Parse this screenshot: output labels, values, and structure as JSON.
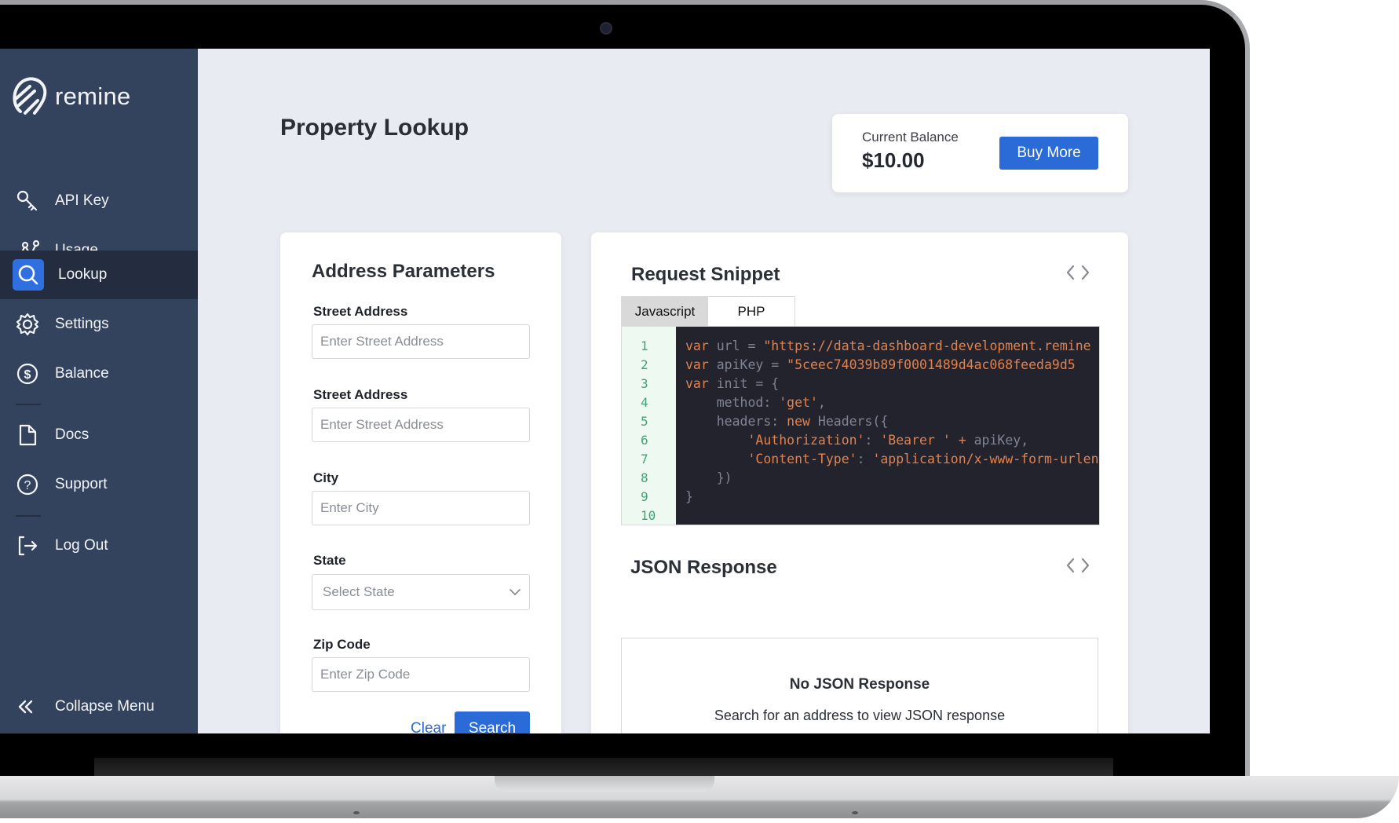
{
  "brand": {
    "name": "remine"
  },
  "sidebar": {
    "items": [
      {
        "label": "API Key",
        "icon": "key-icon"
      },
      {
        "label": "Usage",
        "icon": "usage-graph-icon"
      },
      {
        "label": "Lookup",
        "icon": "search-icon",
        "active": true
      },
      {
        "label": "Settings",
        "icon": "gear-icon"
      },
      {
        "label": "Balance",
        "icon": "dollar-circle-icon"
      },
      {
        "label": "Docs",
        "icon": "document-icon"
      },
      {
        "label": "Support",
        "icon": "help-circle-icon"
      },
      {
        "label": "Log Out",
        "icon": "logout-icon"
      }
    ],
    "collapse_label": "Collapse Menu"
  },
  "page": {
    "title": "Property Lookup"
  },
  "balance": {
    "label": "Current Balance",
    "value": "$10.00",
    "buy_label": "Buy More"
  },
  "address_form": {
    "heading": "Address Parameters",
    "fields": [
      {
        "label": "Street Address",
        "placeholder": "Enter Street Address",
        "value": ""
      },
      {
        "label": "Street Address",
        "placeholder": "Enter Street Address",
        "value": ""
      },
      {
        "label": "City",
        "placeholder": "Enter City",
        "value": ""
      },
      {
        "label": "State",
        "placeholder": "Select State",
        "value": ""
      },
      {
        "label": "Zip Code",
        "placeholder": "Enter Zip Code",
        "value": ""
      }
    ],
    "clear_label": "Clear",
    "search_label": "Search"
  },
  "snippet": {
    "heading": "Request Snippet",
    "tabs": [
      {
        "label": "Javascript",
        "active": true
      },
      {
        "label": "PHP",
        "active": false
      }
    ],
    "line_numbers": [
      "1",
      "2",
      "3",
      "4",
      "5",
      "6",
      "7",
      "8",
      "9",
      "10"
    ],
    "lines": [
      [
        {
          "t": "var ",
          "c": "kw"
        },
        {
          "t": "url = ",
          "c": "pl"
        },
        {
          "t": "\"https://data-dashboard-development.remine",
          "c": "str"
        }
      ],
      [
        {
          "t": "var ",
          "c": "kw"
        },
        {
          "t": "apiKey = ",
          "c": "pl"
        },
        {
          "t": "\"5ceec74039b89f0001489d4ac068feeda9d5",
          "c": "str"
        }
      ],
      [
        {
          "t": "var ",
          "c": "kw"
        },
        {
          "t": "init = {",
          "c": "pl"
        }
      ],
      [
        {
          "t": "    method: ",
          "c": "pl"
        },
        {
          "t": "'get'",
          "c": "str"
        },
        {
          "t": ",",
          "c": "pl"
        }
      ],
      [
        {
          "t": "    headers: ",
          "c": "pl"
        },
        {
          "t": "new ",
          "c": "kw"
        },
        {
          "t": "Headers({",
          "c": "pl"
        }
      ],
      [
        {
          "t": "        ",
          "c": "pl"
        },
        {
          "t": "'Authorization'",
          "c": "str"
        },
        {
          "t": ": ",
          "c": "pl"
        },
        {
          "t": "'Bearer '",
          "c": "str"
        },
        {
          "t": " + ",
          "c": "kw"
        },
        {
          "t": "apiKey,",
          "c": "pl"
        }
      ],
      [
        {
          "t": "        ",
          "c": "pl"
        },
        {
          "t": "'Content-Type'",
          "c": "str"
        },
        {
          "t": ": ",
          "c": "pl"
        },
        {
          "t": "'application/x-www-form-urlencoded'",
          "c": "str"
        }
      ],
      [
        {
          "t": "    })",
          "c": "pl"
        }
      ],
      [
        {
          "t": "}",
          "c": "pl"
        }
      ],
      [
        {
          "t": "",
          "c": "pl"
        }
      ]
    ]
  },
  "json_response": {
    "heading": "JSON Response",
    "empty_title": "No JSON Response",
    "empty_subtitle": "Search for an address to view JSON response"
  },
  "colors": {
    "sidebar": "#33435e",
    "sidebar_active": "#232d3f",
    "accent": "#2a6bd8",
    "page_bg": "#e8ebf1"
  }
}
